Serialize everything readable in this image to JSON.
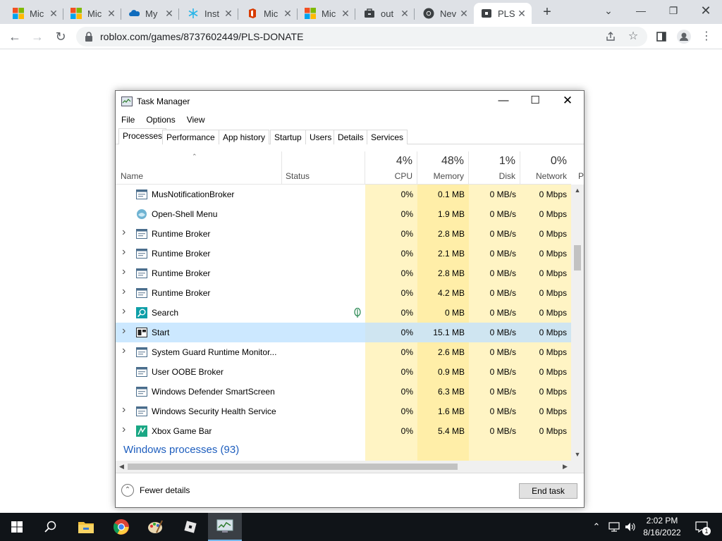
{
  "browser": {
    "tabs": [
      {
        "title": "Mic",
        "favicon": "microsoft-logo"
      },
      {
        "title": "Mic",
        "favicon": "microsoft-logo"
      },
      {
        "title": "My",
        "favicon": "onedrive-cloud"
      },
      {
        "title": "Inst",
        "favicon": "snowflake"
      },
      {
        "title": "Mic",
        "favicon": "office-logo"
      },
      {
        "title": "Mic",
        "favicon": "microsoft-logo"
      },
      {
        "title": "out",
        "favicon": "briefcase"
      },
      {
        "title": "Nev",
        "favicon": "chrome-logo"
      },
      {
        "title": "PLS",
        "favicon": "roblox-icon",
        "active": true
      }
    ],
    "new_tab": "+",
    "url": "roblox.com/games/8737602449/PLS-DONATE"
  },
  "task_manager": {
    "title": "Task Manager",
    "menu": [
      "File",
      "Options",
      "View"
    ],
    "tabs": [
      "Processes",
      "Performance",
      "App history",
      "Startup",
      "Users",
      "Details",
      "Services"
    ],
    "columns": {
      "name": "Name",
      "status": "Status",
      "cpu": {
        "label": "CPU",
        "pct": "4%"
      },
      "memory": {
        "label": "Memory",
        "pct": "48%"
      },
      "disk": {
        "label": "Disk",
        "pct": "1%"
      },
      "network": {
        "label": "Network",
        "pct": "0%"
      },
      "power_partial": "P"
    },
    "processes": [
      {
        "name": "MusNotificationBroker",
        "expandable": false,
        "icon": "app-window-icon",
        "cpu": "0%",
        "memory": "0.1 MB",
        "disk": "0 MB/s",
        "network": "0 Mbps"
      },
      {
        "name": "Open-Shell Menu",
        "expandable": false,
        "icon": "shell-icon",
        "cpu": "0%",
        "memory": "1.9 MB",
        "disk": "0 MB/s",
        "network": "0 Mbps"
      },
      {
        "name": "Runtime Broker",
        "expandable": true,
        "icon": "app-window-icon",
        "cpu": "0%",
        "memory": "2.8 MB",
        "disk": "0 MB/s",
        "network": "0 Mbps"
      },
      {
        "name": "Runtime Broker",
        "expandable": true,
        "icon": "app-window-icon",
        "cpu": "0%",
        "memory": "2.1 MB",
        "disk": "0 MB/s",
        "network": "0 Mbps"
      },
      {
        "name": "Runtime Broker",
        "expandable": true,
        "icon": "app-window-icon",
        "cpu": "0%",
        "memory": "2.8 MB",
        "disk": "0 MB/s",
        "network": "0 Mbps"
      },
      {
        "name": "Runtime Broker",
        "expandable": true,
        "icon": "app-window-icon",
        "cpu": "0%",
        "memory": "4.2 MB",
        "disk": "0 MB/s",
        "network": "0 Mbps"
      },
      {
        "name": "Search",
        "expandable": true,
        "icon": "search-app-icon",
        "status_icon": "leaf",
        "cpu": "0%",
        "memory": "0 MB",
        "disk": "0 MB/s",
        "network": "0 Mbps"
      },
      {
        "name": "Start",
        "expandable": true,
        "icon": "start-app-icon",
        "selected": true,
        "cpu": "0%",
        "memory": "15.1 MB",
        "disk": "0 MB/s",
        "network": "0 Mbps"
      },
      {
        "name": "System Guard Runtime Monitor...",
        "expandable": true,
        "icon": "app-window-icon",
        "cpu": "0%",
        "memory": "2.6 MB",
        "disk": "0 MB/s",
        "network": "0 Mbps"
      },
      {
        "name": "User OOBE Broker",
        "expandable": false,
        "icon": "app-window-icon",
        "cpu": "0%",
        "memory": "0.9 MB",
        "disk": "0 MB/s",
        "network": "0 Mbps"
      },
      {
        "name": "Windows Defender SmartScreen",
        "expandable": false,
        "icon": "app-window-icon",
        "cpu": "0%",
        "memory": "6.3 MB",
        "disk": "0 MB/s",
        "network": "0 Mbps"
      },
      {
        "name": "Windows Security Health Service",
        "expandable": true,
        "icon": "app-window-icon",
        "cpu": "0%",
        "memory": "1.6 MB",
        "disk": "0 MB/s",
        "network": "0 Mbps"
      },
      {
        "name": "Xbox Game Bar",
        "expandable": true,
        "icon": "xbox-icon",
        "cpu": "0%",
        "memory": "5.4 MB",
        "disk": "0 MB/s",
        "network": "0 Mbps"
      }
    ],
    "group_label": "Windows processes (93)",
    "fewer_details": "Fewer details",
    "end_task": "End task"
  },
  "taskbar": {
    "time": "2:02 PM",
    "date": "8/16/2022",
    "notification_count": "1"
  }
}
